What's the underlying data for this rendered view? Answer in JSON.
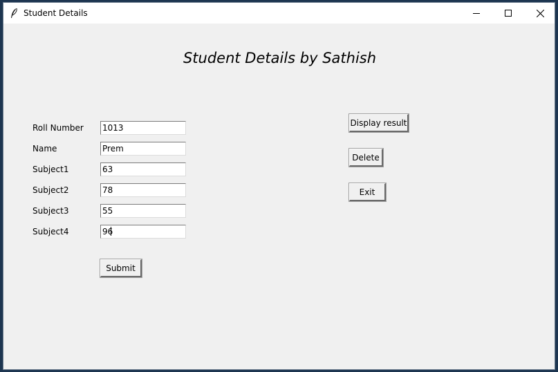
{
  "window": {
    "title": "Student Details"
  },
  "heading": "Student Details by Sathish",
  "form": {
    "fields": [
      {
        "label": "Roll Number",
        "value": "1013"
      },
      {
        "label": "Name",
        "value": "Prem"
      },
      {
        "label": "Subject1",
        "value": "63"
      },
      {
        "label": "Subject2",
        "value": "78"
      },
      {
        "label": "Subject3",
        "value": "55"
      },
      {
        "label": "Subject4",
        "value": "96"
      }
    ],
    "submit_label": "Submit"
  },
  "actions": {
    "display_label": "Display result",
    "delete_label": "Delete",
    "exit_label": "Exit"
  }
}
